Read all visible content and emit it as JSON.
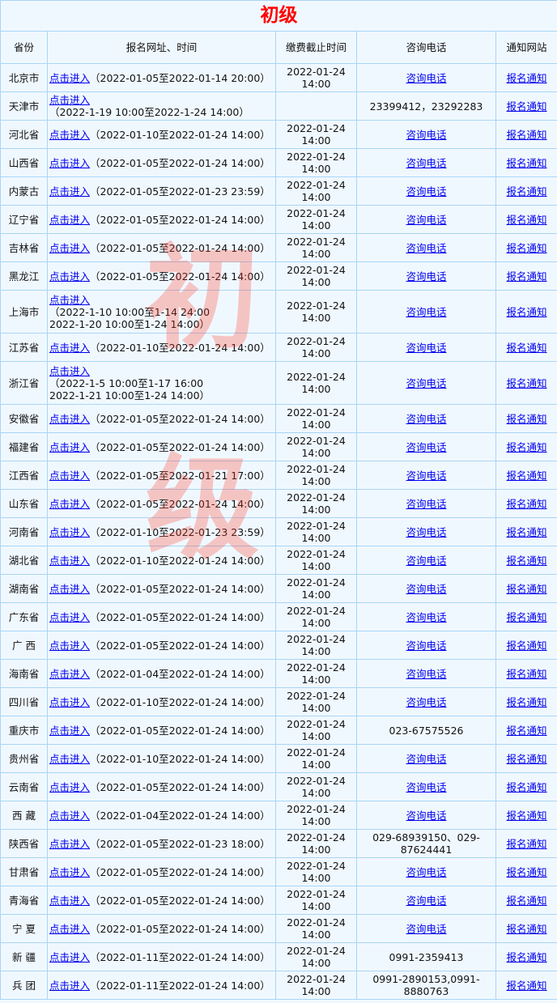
{
  "title": "初级",
  "headers": [
    "省份",
    "报名网址、时间",
    "缴费截止时间",
    "咨询电话",
    "通知网站"
  ],
  "watermark": "初级",
  "link_label": "点击进入",
  "phone_link_label": "咨询电话",
  "notice_label": "报名通知",
  "rows": [
    {
      "province": "北京市",
      "time": "（2022-01-05至2022-01-14 20:00）",
      "deadline": "2022-01-24 14:00",
      "phone": null
    },
    {
      "province": "天津市",
      "time": "（2022-1-19 10:00至2022-1-24 14:00）",
      "deadline": "",
      "phone": "23399412，23292283",
      "newline": true
    },
    {
      "province": "河北省",
      "time": "（2022-01-10至2022-01-24 14:00）",
      "deadline": "2022-01-24 14:00",
      "phone": null
    },
    {
      "province": "山西省",
      "time": "（2022-01-05至2022-01-24 14:00）",
      "deadline": "2022-01-24 14:00",
      "phone": null
    },
    {
      "province": "内蒙古",
      "time": "（2022-01-05至2022-01-23 23:59）",
      "deadline": "2022-01-24 14:00",
      "phone": null
    },
    {
      "province": "辽宁省",
      "time": "（2022-01-05至2022-01-24 14:00）",
      "deadline": "2022-01-24 14:00",
      "phone": null
    },
    {
      "province": "吉林省",
      "time": "（2022-01-05至2022-01-24 14:00）",
      "deadline": "2022-01-24 14:00",
      "phone": null
    },
    {
      "province": "黑龙江",
      "time": "（2022-01-05至2022-01-24 14:00）",
      "deadline": "2022-01-24 14:00",
      "phone": null
    },
    {
      "province": "上海市",
      "time": "（2022-1-10 10:00至1-14 24:00",
      "time2": "2022-1-20 10:00至1-24 14:00）",
      "deadline": "2022-01-24 14:00",
      "phone": null,
      "newline": true,
      "tall": true
    },
    {
      "province": "江苏省",
      "time": "（2022-01-10至2022-01-24 14:00）",
      "deadline": "2022-01-24 14:00",
      "phone": null
    },
    {
      "province": "浙江省",
      "time": "（2022-1-5 10:00至1-17 16:00",
      "time2": "2022-1-21 10:00至1-24 14:00）",
      "deadline": "2022-01-24 14:00",
      "phone": null,
      "newline": true,
      "tall": true
    },
    {
      "province": "安徽省",
      "time": "（2022-01-05至2022-01-24 14:00）",
      "deadline": "2022-01-24 14:00",
      "phone": null
    },
    {
      "province": "福建省",
      "time": "（2022-01-05至2022-01-24 14:00）",
      "deadline": "2022-01-24 14:00",
      "phone": null
    },
    {
      "province": "江西省",
      "time": "（2022-01-05至2022-01-21 17:00）",
      "deadline": "2022-01-24 14:00",
      "phone": null
    },
    {
      "province": "山东省",
      "time": "（2022-01-05至2022-01-24 14:00）",
      "deadline": "2022-01-24 14:00",
      "phone": null
    },
    {
      "province": "河南省",
      "time": "（2022-01-10至2022-01-23 23:59）",
      "deadline": "2022-01-24 14:00",
      "phone": null
    },
    {
      "province": "湖北省",
      "time": "（2022-01-10至2022-01-24 14:00）",
      "deadline": "2022-01-24 14:00",
      "phone": null
    },
    {
      "province": "湖南省",
      "time": "（2022-01-05至2022-01-24 14:00）",
      "deadline": "2022-01-24 14:00",
      "phone": null
    },
    {
      "province": "广东省",
      "time": "（2022-01-05至2022-01-24 14:00）",
      "deadline": "2022-01-24 14:00",
      "phone": null
    },
    {
      "province": "广 西",
      "time": "（2022-01-05至2022-01-24 14:00）",
      "deadline": "2022-01-24 14:00",
      "phone": null
    },
    {
      "province": "海南省",
      "time": "（2022-01-04至2022-01-24 14:00）",
      "deadline": "2022-01-24 14:00",
      "phone": null
    },
    {
      "province": "四川省",
      "time": "（2022-01-10至2022-01-24 14:00）",
      "deadline": "2022-01-24 14:00",
      "phone": null
    },
    {
      "province": "重庆市",
      "time": "（2022-01-05至2022-01-24 14:00）",
      "deadline": "2022-01-24 14:00",
      "phone": "023-67575526"
    },
    {
      "province": "贵州省",
      "time": "（2022-01-10至2022-01-24 14:00）",
      "deadline": "2022-01-24 14:00",
      "phone": null
    },
    {
      "province": "云南省",
      "time": "（2022-01-05至2022-01-24 14:00）",
      "deadline": "2022-01-24 14:00",
      "phone": null
    },
    {
      "province": "西 藏",
      "time": "（2022-01-04至2022-01-24 14:00）",
      "deadline": "2022-01-24 14:00",
      "phone": null
    },
    {
      "province": "陕西省",
      "time": "（2022-01-05至2022-01-23 18:00）",
      "deadline": "2022-01-24 14:00",
      "phone": "029-68939150、029-87624441"
    },
    {
      "province": "甘肃省",
      "time": "（2022-01-05至2022-01-24 14:00）",
      "deadline": "2022-01-24 14:00",
      "phone": null
    },
    {
      "province": "青海省",
      "time": "（2022-01-05至2022-01-24 14:00）",
      "deadline": "2022-01-24 14:00",
      "phone": null
    },
    {
      "province": "宁 夏",
      "time": "（2022-01-05至2022-01-24 14:00）",
      "deadline": "2022-01-24 14:00",
      "phone": null
    },
    {
      "province": "新 疆",
      "time": "（2022-01-11至2022-01-24 14:00）",
      "deadline": "2022-01-24 14:00",
      "phone": "0991-2359413"
    },
    {
      "province": "兵 团",
      "time": "（2022-01-11至2022-01-24 14:00）",
      "deadline": "2022-01-24 14:00",
      "phone": "0991-2890153,0991-8880763"
    }
  ]
}
